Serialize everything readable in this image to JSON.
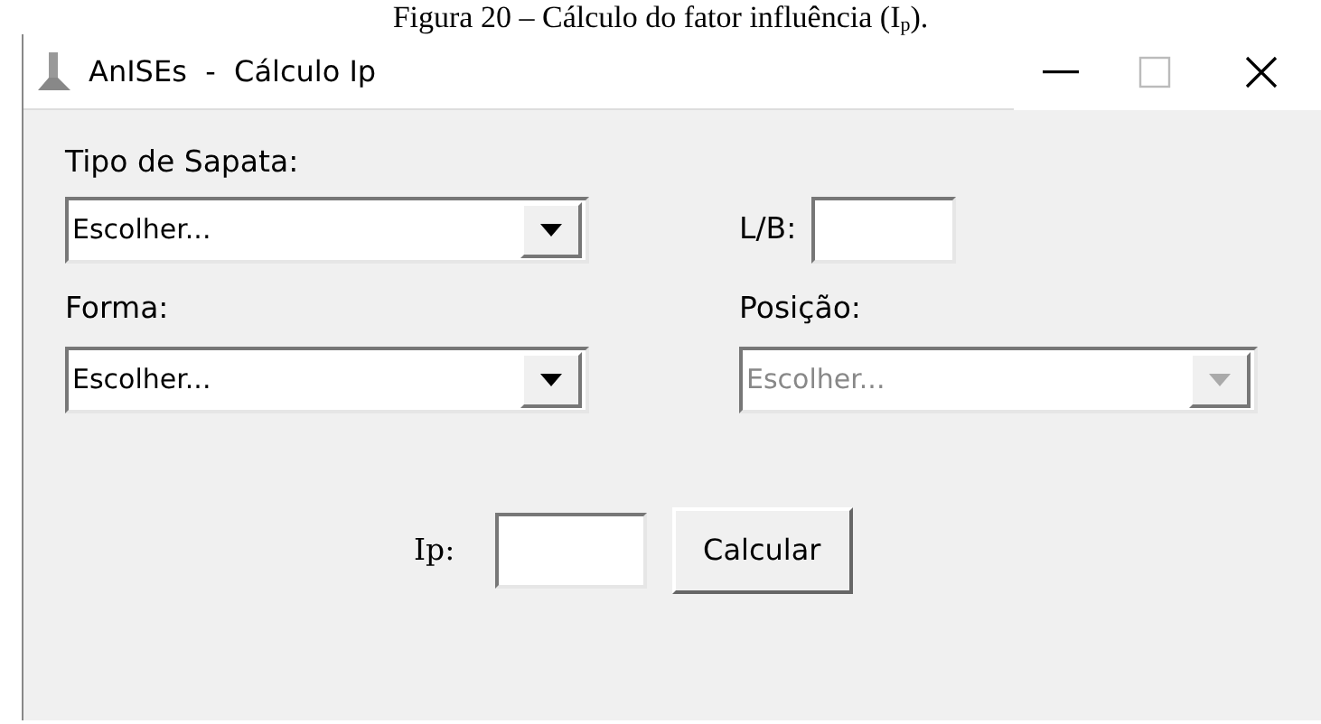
{
  "caption": "Figura 20 – Cálculo do fator influência (I$_{p}$).",
  "window": {
    "title": "AnISEs  -  Cálculo Ip",
    "maximize_disabled": true
  },
  "tipo_de_sapata": {
    "label": "Tipo de Sapata:",
    "value": "Escolher...",
    "disabled": false
  },
  "l_b": {
    "label": "L/B:"
  },
  "forma": {
    "label": "Forma:",
    "value": "Escolher...",
    "disabled": false
  },
  "posicao": {
    "label": "Posição:",
    "value": "Escolher...",
    "disabled": true
  },
  "ip": {
    "label": "Ip:"
  },
  "button": "Calcular"
}
